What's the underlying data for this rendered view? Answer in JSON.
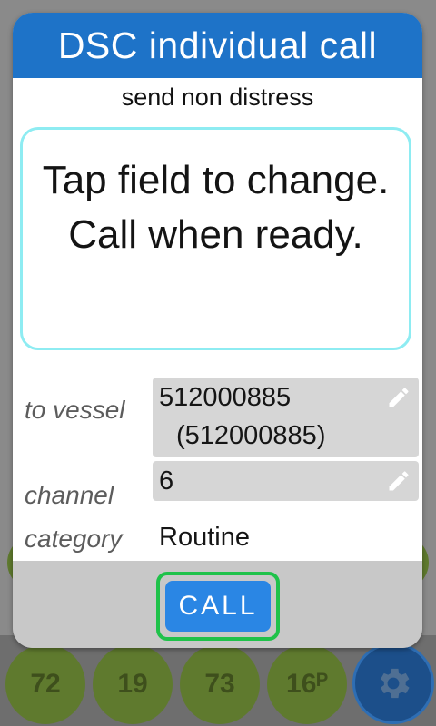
{
  "background": {
    "channel_bubbles": [
      "72",
      "19",
      "73",
      "16ᴾ"
    ]
  },
  "dialog": {
    "title": "DSC individual call",
    "subtitle": "send non distress",
    "message_line1": "Tap field to change.",
    "message_line2": "Call when ready.",
    "fields": {
      "to_vessel": {
        "label": "to vessel",
        "value": "512000885",
        "value_secondary": "(512000885)"
      },
      "channel": {
        "label": "channel",
        "value": "6"
      },
      "category": {
        "label": "category",
        "value": "Routine"
      }
    },
    "call_label": "CALL"
  },
  "colors": {
    "title_bar": "#1e73c8",
    "call_button": "#2a86e4",
    "call_ring": "#1fc24a",
    "message_border": "#8eecf2"
  }
}
